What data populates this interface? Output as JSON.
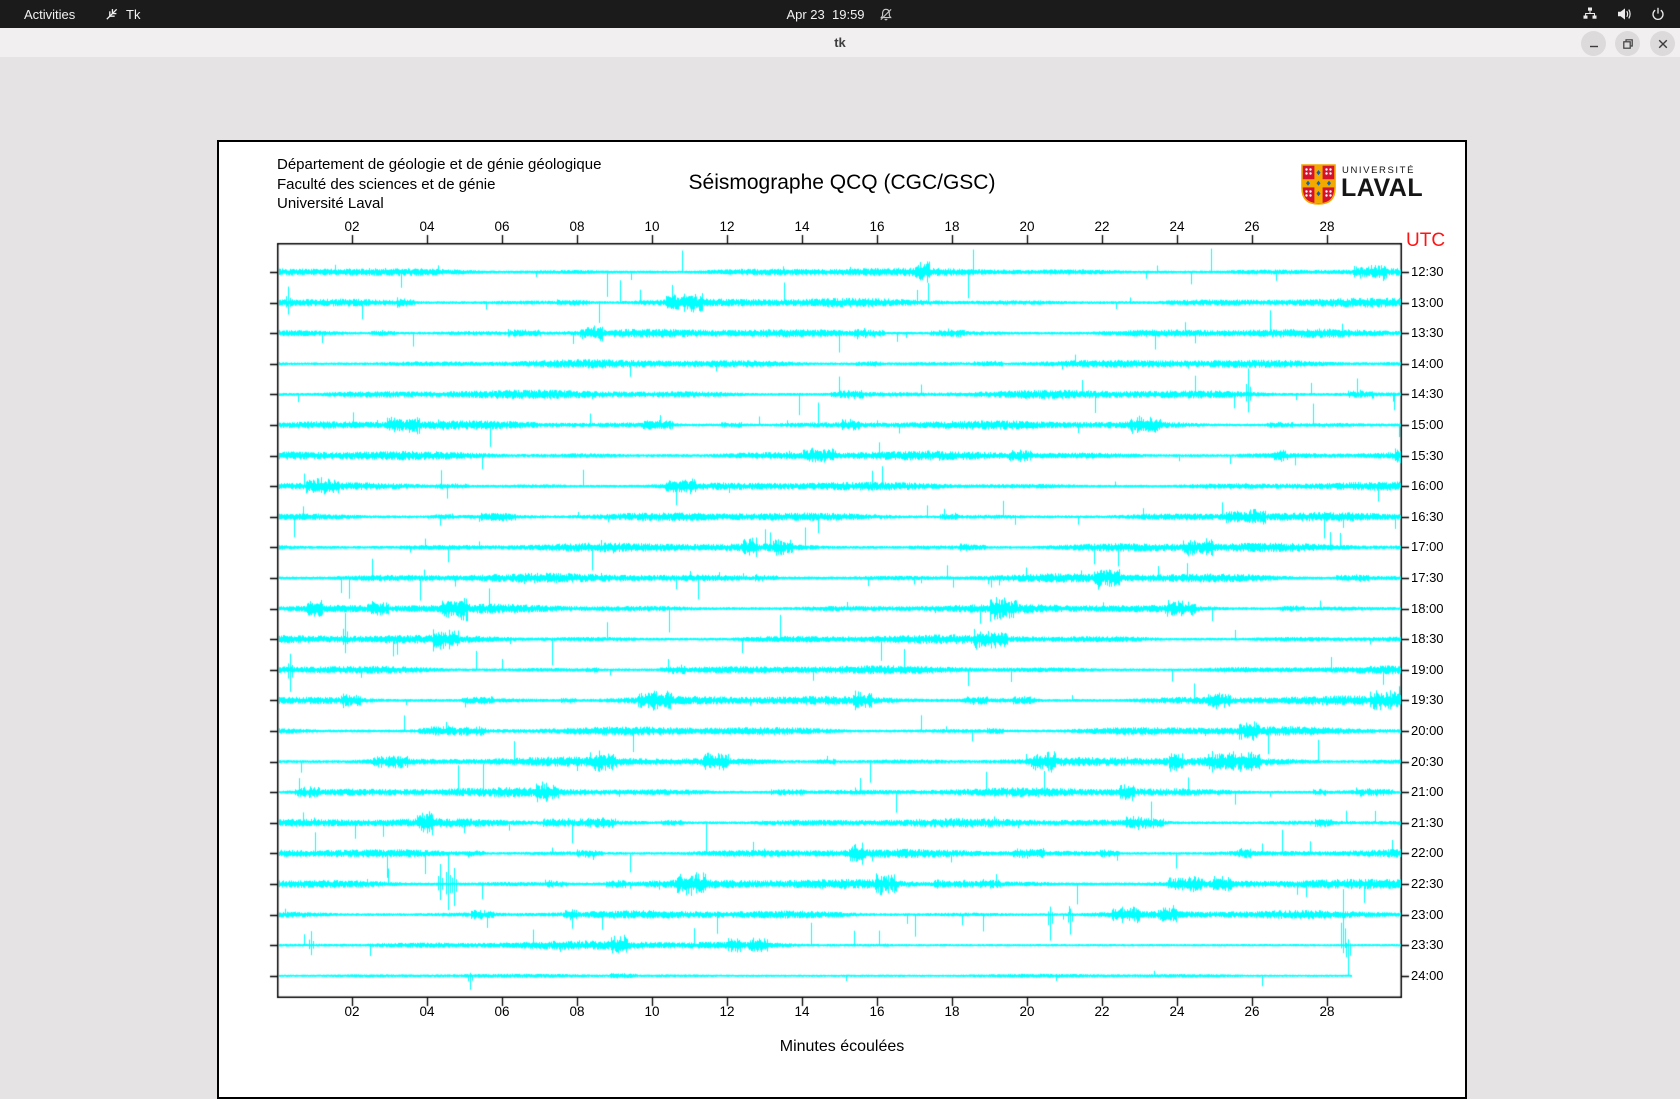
{
  "topbar": {
    "activities_label": "Activities",
    "app_indicator": {
      "icon": "tk-logo-icon",
      "label": "Tk"
    },
    "clock": "Apr 23  19:59",
    "status_icons": [
      "notifications-disabled-icon",
      "network-wired-icon",
      "volume-icon",
      "power-icon"
    ]
  },
  "titlebar": {
    "title": "tk",
    "window_controls": [
      "minimize",
      "restore",
      "close"
    ]
  },
  "document": {
    "dept_lines": [
      "Département de géologie et de génie géologique",
      "Faculté des sciences et de génie",
      "Université Laval"
    ],
    "logo": {
      "small": "UNIVERSITÉ",
      "large": "LAVAL"
    }
  },
  "chart_data": {
    "type": "line",
    "subtype": "helicorder_seismogram",
    "title": "Séismographe QCQ (CGC/GSC)",
    "xlabel": "Minutes écoulées",
    "x_axis": {
      "min": 0,
      "max": 30,
      "ticks": [
        "02",
        "04",
        "06",
        "08",
        "10",
        "12",
        "14",
        "16",
        "18",
        "20",
        "22",
        "24",
        "26",
        "28"
      ],
      "tick_minutes": [
        2,
        4,
        6,
        8,
        10,
        12,
        14,
        16,
        18,
        20,
        22,
        24,
        26,
        28
      ]
    },
    "y_axis": {
      "title": "UTC",
      "title_color": "#ff1414",
      "labels": [
        "12:30",
        "13:00",
        "13:30",
        "14:00",
        "14:30",
        "15:00",
        "15:30",
        "16:00",
        "16:30",
        "17:00",
        "17:30",
        "18:00",
        "18:30",
        "19:00",
        "19:30",
        "20:00",
        "20:30",
        "21:00",
        "21:30",
        "22:00",
        "22:30",
        "23:00",
        "23:30",
        "24:00"
      ]
    },
    "trace_color": "#00ffff",
    "grid": false,
    "traces": [
      {
        "label": "12:30",
        "seed": 101,
        "amp": 2.4,
        "spike_rate": 0.012,
        "spike_max": 22,
        "burst_rate": 0.004
      },
      {
        "label": "13:00",
        "seed": 102,
        "amp": 2.6,
        "spike_rate": 0.01,
        "spike_max": 18,
        "burst_rate": 0.004,
        "events": [
          {
            "m": 0.3,
            "up": 16,
            "down": 12
          }
        ]
      },
      {
        "label": "13:30",
        "seed": 103,
        "amp": 2.5,
        "spike_rate": 0.012,
        "spike_max": 20,
        "burst_rate": 0.005
      },
      {
        "label": "14:00",
        "seed": 104,
        "amp": 2.4,
        "spike_rate": 0.01,
        "spike_max": 16,
        "burst_rate": 0.004
      },
      {
        "label": "14:30",
        "seed": 105,
        "amp": 2.6,
        "spike_rate": 0.011,
        "spike_max": 20,
        "burst_rate": 0.005,
        "events": [
          {
            "m": 25.9,
            "up": 26,
            "down": 18
          }
        ]
      },
      {
        "label": "15:00",
        "seed": 106,
        "amp": 2.5,
        "spike_rate": 0.012,
        "spike_max": 18,
        "burst_rate": 0.004
      },
      {
        "label": "15:30",
        "seed": 107,
        "amp": 2.7,
        "spike_rate": 0.01,
        "spike_max": 16,
        "burst_rate": 0.005
      },
      {
        "label": "16:00",
        "seed": 108,
        "amp": 2.4,
        "spike_rate": 0.011,
        "spike_max": 18,
        "burst_rate": 0.004
      },
      {
        "label": "16:30",
        "seed": 109,
        "amp": 2.5,
        "spike_rate": 0.012,
        "spike_max": 20,
        "burst_rate": 0.005
      },
      {
        "label": "17:00",
        "seed": 110,
        "amp": 2.6,
        "spike_rate": 0.013,
        "spike_max": 20,
        "burst_rate": 0.005
      },
      {
        "label": "17:30",
        "seed": 111,
        "amp": 2.7,
        "spike_rate": 0.013,
        "spike_max": 22,
        "burst_rate": 0.006
      },
      {
        "label": "18:00",
        "seed": 112,
        "amp": 2.6,
        "spike_rate": 0.012,
        "spike_max": 20,
        "burst_rate": 0.005
      },
      {
        "label": "18:30",
        "seed": 113,
        "amp": 2.5,
        "spike_rate": 0.012,
        "spike_max": 22,
        "burst_rate": 0.005,
        "events": [
          {
            "m": 1.8,
            "up": 26,
            "down": 14
          }
        ]
      },
      {
        "label": "19:00",
        "seed": 114,
        "amp": 2.4,
        "spike_rate": 0.01,
        "spike_max": 18,
        "burst_rate": 0.004,
        "events": [
          {
            "m": 0.35,
            "up": 16,
            "down": 22
          }
        ]
      },
      {
        "label": "19:30",
        "seed": 115,
        "amp": 2.6,
        "spike_rate": 0.011,
        "spike_max": 18,
        "burst_rate": 0.005
      },
      {
        "label": "20:00",
        "seed": 116,
        "amp": 2.5,
        "spike_rate": 0.012,
        "spike_max": 20,
        "burst_rate": 0.005
      },
      {
        "label": "20:30",
        "seed": 117,
        "amp": 2.7,
        "spike_rate": 0.013,
        "spike_max": 22,
        "burst_rate": 0.006
      },
      {
        "label": "21:00",
        "seed": 118,
        "amp": 2.6,
        "spike_rate": 0.013,
        "spike_max": 24,
        "burst_rate": 0.006
      },
      {
        "label": "21:30",
        "seed": 119,
        "amp": 2.5,
        "spike_rate": 0.012,
        "spike_max": 20,
        "burst_rate": 0.005
      },
      {
        "label": "22:00",
        "seed": 120,
        "amp": 2.5,
        "spike_rate": 0.012,
        "spike_max": 20,
        "burst_rate": 0.005
      },
      {
        "label": "22:30",
        "seed": 121,
        "amp": 2.8,
        "spike_rate": 0.013,
        "spike_max": 22,
        "burst_rate": 0.006,
        "events": [
          {
            "m": 4.35,
            "up": 20,
            "down": 16
          },
          {
            "m": 4.55,
            "up": 30,
            "down": 26
          },
          {
            "m": 4.72,
            "up": 16,
            "down": 22
          }
        ]
      },
      {
        "label": "23:00",
        "seed": 122,
        "amp": 2.4,
        "spike_rate": 0.011,
        "spike_max": 18,
        "burst_rate": 0.005,
        "events": [
          {
            "m": 20.6,
            "up": 8,
            "down": 26
          },
          {
            "m": 21.15,
            "up": 6,
            "down": 20
          }
        ]
      },
      {
        "label": "23:30",
        "seed": 123,
        "amp": 2.5,
        "spike_rate": 0.011,
        "spike_max": 18,
        "burst_rate": 0.005,
        "quiet_after": 16.3,
        "events": [
          {
            "m": 0.9,
            "up": 14,
            "down": 10
          },
          {
            "m": 28.42,
            "up": 56,
            "down": 8
          },
          {
            "m": 28.56,
            "up": 6,
            "down": 30
          }
        ]
      },
      {
        "label": "24:00",
        "seed": 124,
        "amp": 0.9,
        "spike_rate": 0.004,
        "spike_max": 10,
        "burst_rate": 0.002,
        "end_min": 28.65,
        "events": [
          {
            "m": 5.15,
            "up": 3,
            "down": 14
          }
        ]
      }
    ]
  }
}
